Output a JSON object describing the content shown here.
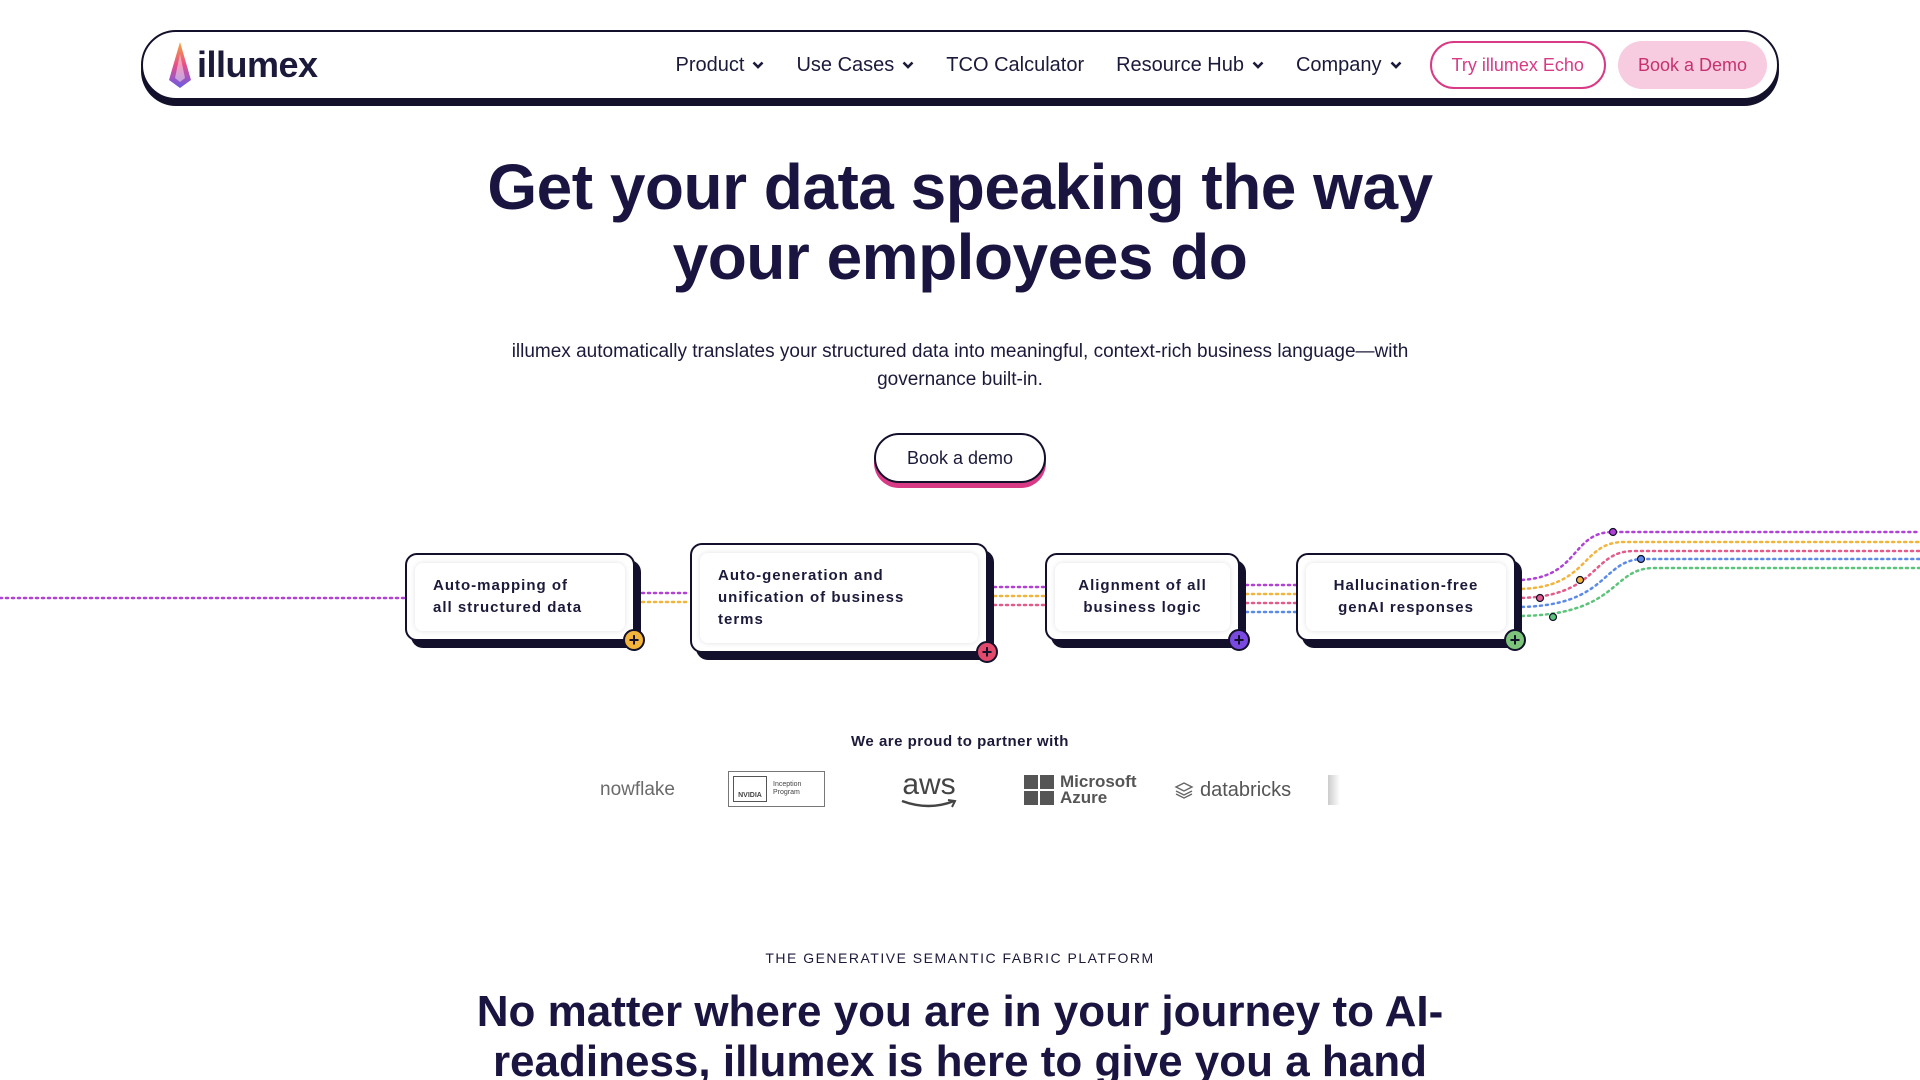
{
  "nav": {
    "logo_text": "illumex",
    "links": [
      {
        "label": "Product",
        "has_dropdown": true
      },
      {
        "label": "Use Cases",
        "has_dropdown": true
      },
      {
        "label": "TCO Calculator",
        "has_dropdown": false
      },
      {
        "label": "Resource Hub",
        "has_dropdown": true
      },
      {
        "label": "Company",
        "has_dropdown": true
      }
    ],
    "try_button": "Try illumex Echo",
    "demo_button": "Book a Demo"
  },
  "hero": {
    "title_line1": "Get your data speaking the way",
    "title_line2": "your employees do",
    "subtitle_line1": "illumex automatically translates your structured data into meaningful, context-rich business language—with",
    "subtitle_line2": "governance built-in.",
    "cta": "Book a demo"
  },
  "flow": {
    "cards": [
      {
        "line1": "Auto-mapping of",
        "line2": "all  structured data",
        "line3": "",
        "accent": "#f2b43a"
      },
      {
        "line1": "Auto-generation and",
        "line2": "unification of business",
        "line3": "terms",
        "accent": "#e24a6c"
      },
      {
        "line1": "Alignment of all",
        "line2": "business logic",
        "line3": "",
        "accent": "#7a4ae0"
      },
      {
        "line1": "Hallucination-free",
        "line2": "genAI responses",
        "line3": "",
        "accent": "#7cc47a"
      }
    ],
    "line_colors": [
      "#b042d6",
      "#f2b43a",
      "#e35b8a",
      "#5b8ae8",
      "#5cc47a"
    ]
  },
  "partners": {
    "label": "We are proud to partner with",
    "logos": {
      "snowflake": "nowflake",
      "nvidia_brand": "NVIDIA",
      "nvidia_program": "Inception Program",
      "aws": "aws",
      "microsoft": "Microsoft",
      "azure": "Azure",
      "databricks": "databricks"
    }
  },
  "section2": {
    "eyebrow": "THE GENERATIVE SEMANTIC FABRIC PLATFORM",
    "title_line1": "No matter where you are in your journey to AI-",
    "title_line2": "readiness, illumex is here to give you a hand"
  },
  "colors": {
    "navy": "#1a1440",
    "pink": "#d83a86",
    "pink_light": "#f7cbe0"
  }
}
